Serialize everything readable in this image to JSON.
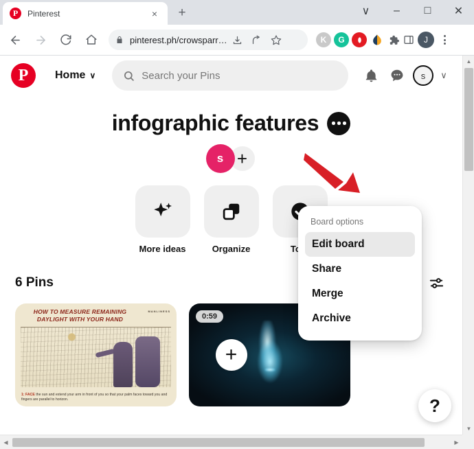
{
  "browser": {
    "tab": {
      "title": "Pinterest",
      "favicon": "pinterest-favicon",
      "close_label": "×"
    },
    "new_tab_label": "+",
    "window_controls": {
      "minimize": "–",
      "maximize": "□",
      "close": "✕",
      "tab_search": "∨"
    },
    "nav": {
      "back": "←",
      "forward": "→",
      "reload": "↻",
      "home": "⌂"
    },
    "omnibox": {
      "url": "pinterest.ph/crowsparr…",
      "lock_icon": "lock-icon",
      "install_icon": "install-app-icon",
      "share_icon": "share-icon",
      "bookmark_icon": "star-icon"
    },
    "extensions": [
      {
        "name": "kaspersky-extension",
        "glyph": "K",
        "color": "#c9c9c9",
        "text_color": "#ffffff"
      },
      {
        "name": "grammarly-extension",
        "glyph": "G",
        "color": "#15c39a",
        "text_color": "#ffffff"
      },
      {
        "name": "opera-extension",
        "glyph": "●",
        "color": "#e31b23",
        "text_color": "#ffffff"
      },
      {
        "name": "honey-extension",
        "glyph": "◐",
        "color": "#f5a623",
        "text_color": "#ffffff"
      }
    ],
    "puzzle_icon": "extensions-puzzle-icon",
    "sidepanel_icon": "side-panel-icon",
    "profile": {
      "name": "profile-avatar",
      "initial": "J"
    },
    "menu_icon": "browser-menu-icon"
  },
  "pinterest": {
    "logo": "P",
    "home_label": "Home",
    "home_chevron": "∨",
    "search": {
      "placeholder": "Search your Pins",
      "value": "",
      "icon": "search-icon"
    },
    "header_icons": {
      "notifications": "bell-icon",
      "messages": "chat-bubble-icon",
      "account_initial": "s",
      "account_chevron": "∨"
    },
    "board": {
      "title": "infographic features",
      "more_button": "board-more-options",
      "collaborator_initial": "s",
      "add_collaborator": "+"
    },
    "tiles": [
      {
        "label": "More ideas",
        "icon": "sparkle-icon"
      },
      {
        "label": "Organize",
        "icon": "organize-squares-icon"
      },
      {
        "label": "To-d",
        "icon": "checkmark-circle-icon"
      }
    ],
    "pins_section": {
      "count_label": "6 Pins",
      "filter_icon": "filter-sliders-icon",
      "add_pin_label": "+"
    },
    "pins": [
      {
        "name": "pin-daylight-infographic",
        "title": "HOW TO MEASURE REMAINING DAYLIGHT WITH YOUR HAND",
        "brand": "MANLINESS",
        "caption_step": "1: FACE",
        "caption_text": " the sun and extend your arm in front of you so that your palm faces toward you and fingers are parallel to horizon."
      },
      {
        "name": "pin-blue-flame-video",
        "duration": "0:59"
      }
    ],
    "help_button": "?"
  },
  "menu": {
    "heading": "Board options",
    "items": [
      {
        "label": "Edit board",
        "active": true
      },
      {
        "label": "Share",
        "active": false
      },
      {
        "label": "Merge",
        "active": false
      },
      {
        "label": "Archive",
        "active": false
      }
    ]
  },
  "annotation": {
    "arrow": "red-arrow-pointing-to-more-options",
    "color": "#d81f26"
  },
  "scrollbars": {
    "vertical": {
      "up": "▲",
      "down": "▼"
    },
    "horizontal": {
      "left": "◀",
      "right": "▶"
    }
  }
}
